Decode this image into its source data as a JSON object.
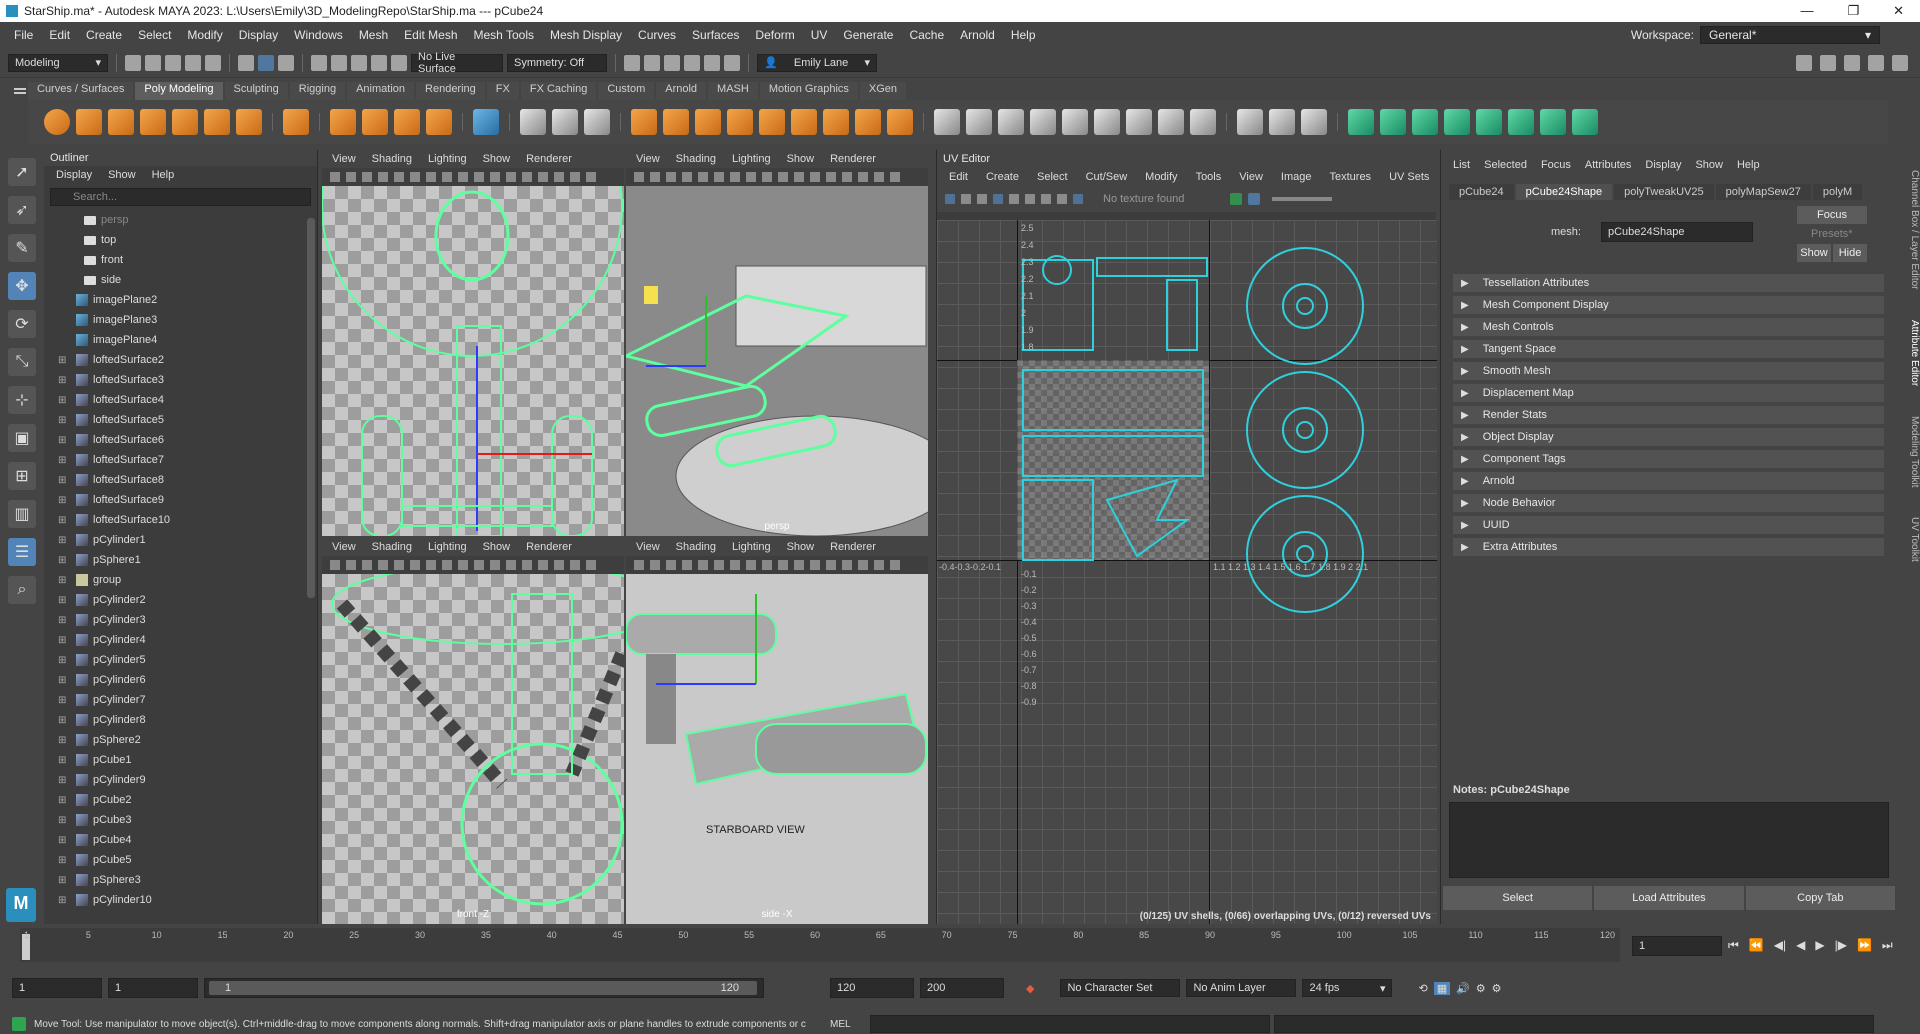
{
  "window": {
    "title": "StarShip.ma* - Autodesk MAYA 2023: L:\\Users\\Emily\\3D_ModelingRepo\\StarShip.ma  ---  pCube24",
    "controls": [
      "—",
      "❐",
      "✕"
    ]
  },
  "menubar": {
    "items": [
      "File",
      "Edit",
      "Create",
      "Select",
      "Modify",
      "Display",
      "Windows",
      "Mesh",
      "Edit Mesh",
      "Mesh Tools",
      "Mesh Display",
      "Curves",
      "Surfaces",
      "Deform",
      "UV",
      "Generate",
      "Cache",
      "Arnold",
      "Help"
    ],
    "workspace_label": "Workspace:",
    "workspace_value": "General*"
  },
  "statusline": {
    "menuset": "Modeling",
    "live_surface": "No Live Surface",
    "symmetry": "Symmetry: Off",
    "user": "Emily Lane"
  },
  "shelf": {
    "tabs": [
      "Curves / Surfaces",
      "Poly Modeling",
      "Sculpting",
      "Rigging",
      "Animation",
      "Rendering",
      "FX",
      "FX Caching",
      "Custom",
      "Arnold",
      "MASH",
      "Motion Graphics",
      "XGen"
    ],
    "active": "Poly Modeling"
  },
  "outliner": {
    "title": "Outliner",
    "menu": [
      "Display",
      "Show",
      "Help"
    ],
    "search_placeholder": "Search...",
    "items": [
      {
        "label": "persp",
        "icon": "camera",
        "exp": ""
      },
      {
        "label": "top",
        "icon": "camera",
        "exp": ""
      },
      {
        "label": "front",
        "icon": "camera",
        "exp": ""
      },
      {
        "label": "side",
        "icon": "camera",
        "exp": ""
      },
      {
        "label": "imagePlane2",
        "icon": "image",
        "exp": ""
      },
      {
        "label": "imagePlane3",
        "icon": "image",
        "exp": ""
      },
      {
        "label": "imagePlane4",
        "icon": "image",
        "exp": ""
      },
      {
        "label": "loftedSurface2",
        "icon": "mesh",
        "exp": "⊞"
      },
      {
        "label": "loftedSurface3",
        "icon": "mesh",
        "exp": "⊞"
      },
      {
        "label": "loftedSurface4",
        "icon": "mesh",
        "exp": "⊞"
      },
      {
        "label": "loftedSurface5",
        "icon": "mesh",
        "exp": "⊞"
      },
      {
        "label": "loftedSurface6",
        "icon": "mesh",
        "exp": "⊞"
      },
      {
        "label": "loftedSurface7",
        "icon": "mesh",
        "exp": "⊞"
      },
      {
        "label": "loftedSurface8",
        "icon": "mesh",
        "exp": "⊞"
      },
      {
        "label": "loftedSurface9",
        "icon": "mesh",
        "exp": "⊞"
      },
      {
        "label": "loftedSurface10",
        "icon": "mesh",
        "exp": "⊞"
      },
      {
        "label": "pCylinder1",
        "icon": "mesh",
        "exp": "⊞"
      },
      {
        "label": "pSphere1",
        "icon": "mesh",
        "exp": "⊞"
      },
      {
        "label": "group",
        "icon": "group",
        "exp": "⊞"
      },
      {
        "label": "pCylinder2",
        "icon": "mesh",
        "exp": "⊞"
      },
      {
        "label": "pCylinder3",
        "icon": "mesh",
        "exp": "⊞"
      },
      {
        "label": "pCylinder4",
        "icon": "mesh",
        "exp": "⊞"
      },
      {
        "label": "pCylinder5",
        "icon": "mesh",
        "exp": "⊞"
      },
      {
        "label": "pCylinder6",
        "icon": "mesh",
        "exp": "⊞"
      },
      {
        "label": "pCylinder7",
        "icon": "mesh",
        "exp": "⊞"
      },
      {
        "label": "pCylinder8",
        "icon": "mesh",
        "exp": "⊞"
      },
      {
        "label": "pSphere2",
        "icon": "mesh",
        "exp": "⊞"
      },
      {
        "label": "pCube1",
        "icon": "mesh",
        "exp": "⊞"
      },
      {
        "label": "pCylinder9",
        "icon": "mesh",
        "exp": "⊞"
      },
      {
        "label": "pCube2",
        "icon": "mesh",
        "exp": "⊞"
      },
      {
        "label": "pCube3",
        "icon": "mesh",
        "exp": "⊞"
      },
      {
        "label": "pCube4",
        "icon": "mesh",
        "exp": "⊞"
      },
      {
        "label": "pCube5",
        "icon": "mesh",
        "exp": "⊞"
      },
      {
        "label": "pSphere3",
        "icon": "mesh",
        "exp": "⊞"
      },
      {
        "label": "pCylinder10",
        "icon": "mesh",
        "exp": "⊞"
      }
    ]
  },
  "viewports": {
    "menu": [
      "View",
      "Shading",
      "Lighting",
      "Show",
      "Renderer"
    ],
    "labels": [
      "",
      "persp",
      "front -Z",
      "side -X"
    ],
    "starboard": "STARBOARD VIEW"
  },
  "uv_editor": {
    "title": "UV Editor",
    "menu": [
      "Edit",
      "Create",
      "Select",
      "Cut/Sew",
      "Modify",
      "Tools",
      "View",
      "Image",
      "Textures",
      "UV Sets"
    ],
    "texture": "No texture found",
    "status": "(0/125) UV shells, (0/66) overlapping UVs, (0/12) reversed UVs",
    "v_ticks": [
      "2.5",
      "2.4",
      "2.3",
      "2.2",
      "2.1",
      "2",
      "1.9",
      "1.8"
    ],
    "v_neg": [
      "-0.1",
      "-0.2",
      "-0.3",
      "-0.4",
      "-0.5",
      "-0.6",
      "-0.7",
      "-0.8",
      "-0.9"
    ],
    "u_neg": "-0.4-0.3-0.2-0.1",
    "u_pos": "1.1 1.2 1.3 1.4 1.5 1.6 1.7 1.8 1.9 2   2.1"
  },
  "attribute_editor": {
    "menu": [
      "List",
      "Selected",
      "Focus",
      "Attributes",
      "Display",
      "Show",
      "Help"
    ],
    "tabs": [
      "pCube24",
      "pCube24Shape",
      "polyTweakUV25",
      "polyMapSew27",
      "polyM"
    ],
    "active_tab": "pCube24Shape",
    "mesh_label": "mesh:",
    "mesh_value": "pCube24Shape",
    "focus": "Focus",
    "presets": "Presets*",
    "show": "Show",
    "hide": "Hide",
    "sections": [
      "Tessellation Attributes",
      "Mesh Component Display",
      "Mesh Controls",
      "Tangent Space",
      "Smooth Mesh",
      "Displacement Map",
      "Render Stats",
      "Object Display",
      "Component Tags",
      "Arnold",
      "Node Behavior",
      "UUID",
      "Extra Attributes"
    ],
    "notes": "Notes:  pCube24Shape",
    "buttons": [
      "Select",
      "Load Attributes",
      "Copy Tab"
    ]
  },
  "right_strip": [
    "Channel Box / Layer Editor",
    "Attribute Editor",
    "Modeling Toolkit",
    "UV Toolkit"
  ],
  "timeline": {
    "ticks": [
      "1",
      "5",
      "10",
      "15",
      "20",
      "25",
      "30",
      "35",
      "40",
      "45",
      "50",
      "55",
      "60",
      "65",
      "70",
      "75",
      "80",
      "85",
      "90",
      "95",
      "100",
      "105",
      "110",
      "115",
      "120"
    ],
    "current": "1"
  },
  "range": {
    "start": "1",
    "start2": "1",
    "slider_start": "1",
    "slider_end": "120",
    "end": "120",
    "end2": "200",
    "character": "No Character Set",
    "anim_layer": "No Anim Layer",
    "fps": "24 fps"
  },
  "helpline": {
    "text": "Move Tool: Use manipulator to move object(s). Ctrl+middle-drag to move components along normals. Shift+drag manipulator axis or plane handles to extrude components or c",
    "mel": "MEL"
  },
  "colors": {
    "accent": "#5284b8",
    "uv_shell": "#2ed0dc",
    "wire": "#5dff9e"
  }
}
